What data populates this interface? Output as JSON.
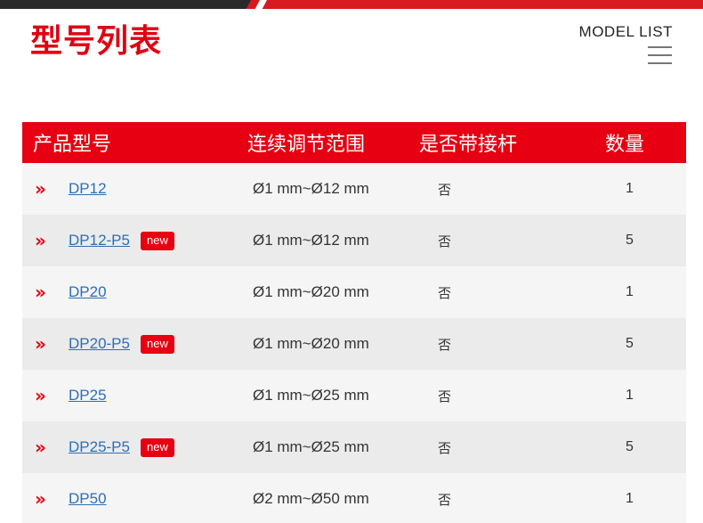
{
  "header": {
    "title": "型号列表",
    "model_list_label": "MODEL LIST"
  },
  "colors": {
    "accent": "#e60012",
    "link": "#2c6fb5",
    "row_odd": "#f5f5f5",
    "row_even": "#ebebeb"
  },
  "table": {
    "columns": [
      "产品型号",
      "连续调节范围",
      "是否带接杆",
      "数量"
    ],
    "rows": [
      {
        "model": "DP12",
        "badge": "",
        "range": "Ø1 mm~Ø12 mm",
        "extension": "否",
        "qty": "1"
      },
      {
        "model": "DP12-P5",
        "badge": "new",
        "range": "Ø1 mm~Ø12 mm",
        "extension": "否",
        "qty": "5"
      },
      {
        "model": "DP20",
        "badge": "",
        "range": "Ø1 mm~Ø20 mm",
        "extension": "否",
        "qty": "1"
      },
      {
        "model": "DP20-P5",
        "badge": "new",
        "range": "Ø1 mm~Ø20 mm",
        "extension": "否",
        "qty": "5"
      },
      {
        "model": "DP25",
        "badge": "",
        "range": "Ø1 mm~Ø25 mm",
        "extension": "否",
        "qty": "1"
      },
      {
        "model": "DP25-P5",
        "badge": "new",
        "range": "Ø1 mm~Ø25 mm",
        "extension": "否",
        "qty": "5"
      },
      {
        "model": "DP50",
        "badge": "",
        "range": "Ø2 mm~Ø50 mm",
        "extension": "否",
        "qty": "1"
      }
    ]
  }
}
